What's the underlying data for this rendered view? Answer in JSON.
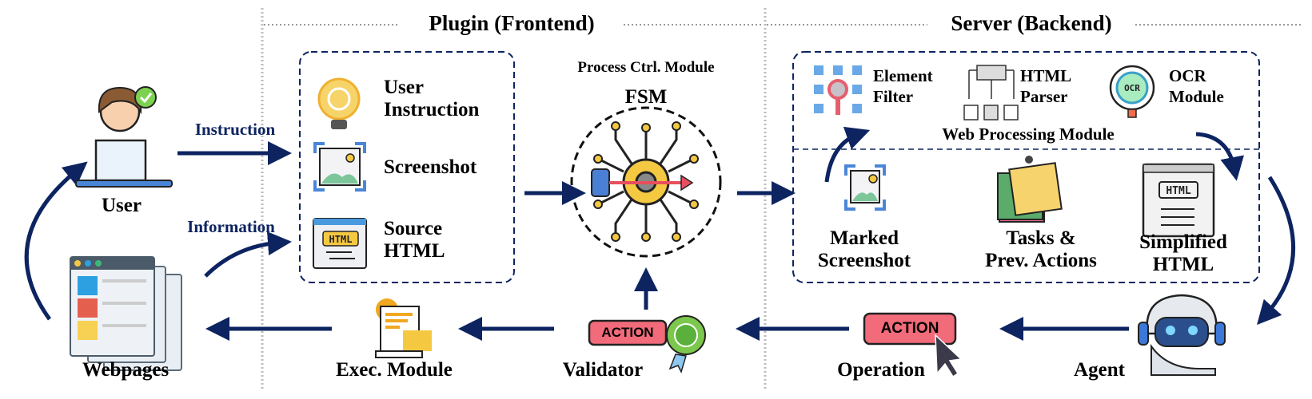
{
  "sections": {
    "frontend": "Plugin (Frontend)",
    "backend": "Server (Backend)"
  },
  "user": {
    "label": "User"
  },
  "webpages": {
    "label": "Webpages"
  },
  "flows": {
    "instruction": "Instruction",
    "information": "Information"
  },
  "plugin_inputs": [
    {
      "line1": "User",
      "line2": "Instruction",
      "icon": "lightbulb-icon"
    },
    {
      "line1": "Screenshot",
      "line2": "",
      "icon": "screenshot-icon"
    },
    {
      "line1": "Source",
      "line2": "HTML",
      "icon": "html-source-icon"
    }
  ],
  "fsm": {
    "title": "Process Ctrl. Module",
    "subtitle": "FSM"
  },
  "web_processing": {
    "title": "Web Processing Module",
    "modules": [
      {
        "line1": "Element",
        "line2": "Filter",
        "icon": "element-filter-icon"
      },
      {
        "line1": "HTML",
        "line2": "Parser",
        "icon": "html-parser-icon"
      },
      {
        "line1": "OCR",
        "line2": "Module",
        "icon": "ocr-icon"
      }
    ],
    "outputs": [
      {
        "line1": "Marked",
        "line2": "Screenshot",
        "icon": "screenshot-icon"
      },
      {
        "line1": "Tasks &",
        "line2": "Prev. Actions",
        "icon": "sticky-notes-icon"
      },
      {
        "line1": "Simplified",
        "line2": "HTML",
        "icon": "html-page-icon"
      }
    ],
    "ocr_badge": "OCR",
    "html_badge": "HTML"
  },
  "agent": {
    "label": "Agent"
  },
  "operation": {
    "label": "Operation",
    "badge": "ACTION"
  },
  "validator": {
    "label": "Validator",
    "badge": "ACTION"
  },
  "exec": {
    "label": "Exec. Module"
  },
  "colors": {
    "arrow": "#0d2461",
    "action_badge": "#f26b7a",
    "divider": "#bbbbbb"
  }
}
